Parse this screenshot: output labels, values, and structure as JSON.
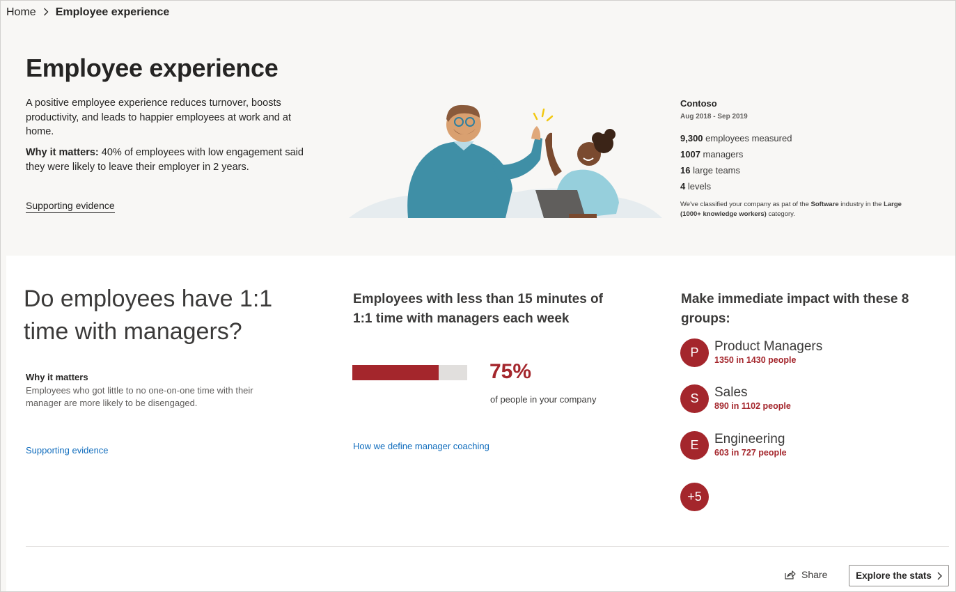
{
  "breadcrumb": {
    "home": "Home",
    "current": "Employee experience"
  },
  "hero": {
    "title": "Employee experience",
    "description": "A positive employee experience reduces turnover, boosts productivity, and leads to happier employees at work and at home.",
    "why_label": "Why it matters:",
    "why_text": " 40% of employees with low engagement said they were likely to leave their employer in 2 years.",
    "link": "Supporting evidence"
  },
  "org": {
    "name": "Contoso",
    "period": "Aug 2018 - Sep 2019",
    "stats": [
      {
        "value": "9,300",
        "label": " employees measured"
      },
      {
        "value": "1007",
        "label": " managers"
      },
      {
        "value": "16",
        "label": " large teams"
      },
      {
        "value": "4",
        "label": " levels"
      }
    ],
    "note_prefix": "We've classified your company as pat of the ",
    "note_industry": "Software",
    "note_middle": " industry in the ",
    "note_category": "Large (1000+ knowledge workers)",
    "note_suffix": " category."
  },
  "question": {
    "title": "Do employees have 1:1 time with managers?",
    "why_heading": "Why it matters",
    "why_text": "Employees who got little to no one-on-one time with their manager are more likely to be disengaged.",
    "link": "Supporting evidence"
  },
  "metric": {
    "title": "Employees with less than 15 minutes of 1:1 time with managers each week",
    "percent": 75,
    "value_label": "75%",
    "caption": "of people in your company",
    "link": "How we define manager coaching"
  },
  "groups": {
    "title": "Make immediate impact with these 8 groups:",
    "items": [
      {
        "initial": "P",
        "name": "Product Managers",
        "count": "1350 in 1430 people"
      },
      {
        "initial": "S",
        "name": "Sales",
        "count": "890 in 1102 people"
      },
      {
        "initial": "E",
        "name": "Engineering",
        "count": "603 in 727 people"
      }
    ],
    "more": "+5"
  },
  "footer": {
    "share": "Share",
    "explore": "Explore the stats"
  },
  "colors": {
    "accent": "#a4262c",
    "link": "#0f6cbd",
    "hero_bg": "#f8f7f5",
    "track": "#e1dfdd"
  }
}
